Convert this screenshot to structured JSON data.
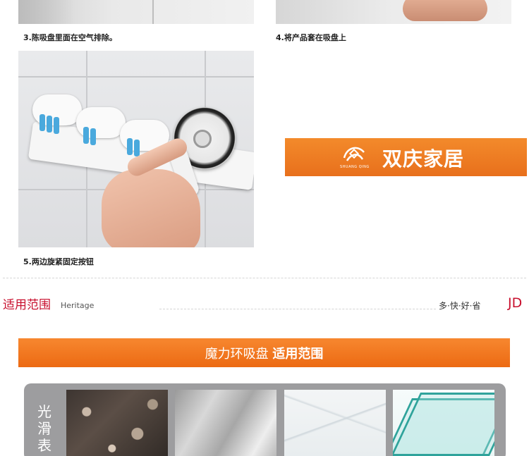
{
  "steps": {
    "step3": "3.陈吸盘里面在空气排除。",
    "step4": "4.将产品套在吸盘上",
    "step5": "5.两边旋紧固定按钮"
  },
  "brand": {
    "name": "双庆家居",
    "sub": "SHUANG QING",
    "color": "#f07a22"
  },
  "section": {
    "title": "适用范围",
    "subtitle": "Heritage",
    "slogan": "多·快·好·省",
    "jd": "JD"
  },
  "usage_bar": {
    "text_plain": "魔力环吸盘",
    "text_bold": "适用范围"
  },
  "surface_panel": {
    "label": "光滑表",
    "swatches": [
      "granite",
      "stainless-steel",
      "marble",
      "glass"
    ]
  },
  "colors": {
    "accent_red": "#c8102e",
    "orange": "#ec6a13",
    "panel_gray": "#9d9d9f",
    "roller_blue": "#4aa9dd"
  }
}
